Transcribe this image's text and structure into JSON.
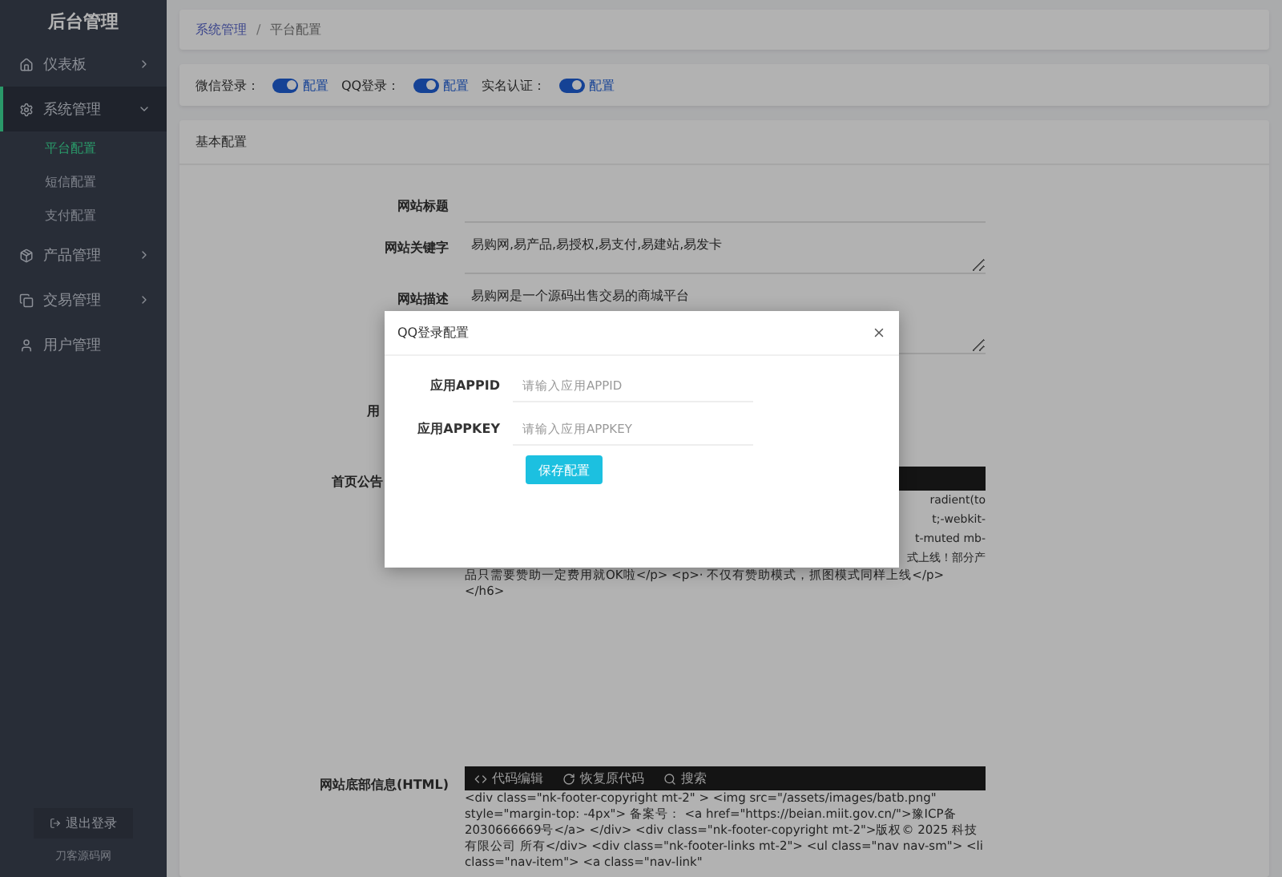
{
  "sidebar": {
    "brand": "后台管理",
    "items": [
      {
        "label": "仪表板",
        "expanded": false
      },
      {
        "label": "系统管理",
        "expanded": true,
        "children": [
          {
            "label": "平台配置",
            "selected": true
          },
          {
            "label": "短信配置",
            "selected": false
          },
          {
            "label": "支付配置",
            "selected": false
          }
        ]
      },
      {
        "label": "产品管理",
        "expanded": false
      },
      {
        "label": "交易管理",
        "expanded": false
      },
      {
        "label": "用户管理"
      }
    ],
    "logout": "退出登录",
    "footer": "刀客源码网"
  },
  "breadcrumb": {
    "items": [
      "系统管理",
      "平台配置"
    ],
    "separator": "/"
  },
  "toggles": [
    {
      "label": "微信登录：",
      "on": true,
      "link": "配置"
    },
    {
      "label": "QQ登录：",
      "on": true,
      "link": "配置"
    },
    {
      "label": "实名认证：",
      "on": true,
      "link": "配置"
    }
  ],
  "card": {
    "title": "基本配置",
    "fields": [
      {
        "kind": "input",
        "label": "网站标题"
      },
      {
        "kind": "textarea",
        "label": "网站关键字",
        "value": "易购网,易产品,易授权,易支付,易建站,易发卡"
      },
      {
        "kind": "textarea",
        "label": "网站描述",
        "value": "易购网是一个源码出售交易的商城平台"
      },
      {
        "kind": "blank",
        "label": "用"
      },
      {
        "kind": "editor",
        "label": "首页公告",
        "lines": [
          {
            "kind": "partial",
            "text": "radient(to"
          },
          {
            "kind": "partial",
            "text": "t;-webkit-"
          },
          {
            "kind": "partial",
            "text": "t-muted mb-"
          },
          {
            "kind": "partial",
            "text": "式上线！部分产"
          },
          {
            "kind": "full",
            "text": "品只需要赞助一定费用就OK啦</p> <p>· 不仅有赞助模式，抓图模式同样上线</p> </h6>"
          }
        ]
      },
      {
        "kind": "editor",
        "label": "网站底部信息(HTML)",
        "tools": [
          "代码编辑",
          "恢复原代码",
          "搜索"
        ],
        "lines": [
          {
            "kind": "full",
            "text": "<div class=\"nk-footer-copyright mt-2\" > <img src=\"/assets/images/batb.png\" style=\"margin-top: -4px\"> 备案号： <a href=\"https://beian.miit.gov.cn/\">豫ICP备2030666669号</a> </div> <div class=\"nk-footer-copyright mt-2\">版权© 2025 科技有限公司 所有</div> <div class=\"nk-footer-links mt-2\"> <ul class=\"nav nav-sm\"> <li class=\"nav-item\"> <a class=\"nav-link\""
          }
        ]
      }
    ]
  },
  "modal": {
    "title": "QQ登录配置",
    "fields": [
      {
        "label": "应用APPID",
        "placeholder": "请输入应用APPID"
      },
      {
        "label": "应用APPKEY",
        "placeholder": "请输入应用APPKEY"
      }
    ],
    "button": "保存配置"
  }
}
